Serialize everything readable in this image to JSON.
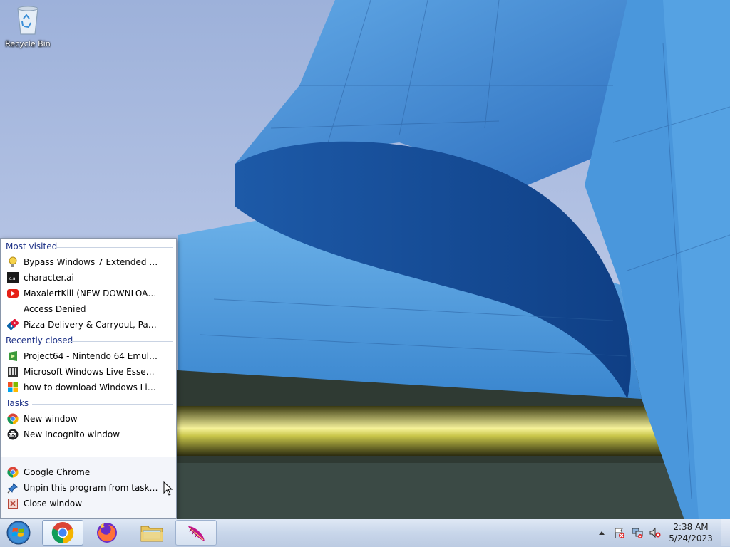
{
  "desktop": {
    "icons": [
      {
        "label": "Recycle Bin",
        "icon": "recycle-bin-icon"
      }
    ]
  },
  "jumplist": {
    "most_visited_header": "Most visited",
    "most_visited": [
      {
        "label": "Bypass Windows 7 Extended Sec...",
        "icon": "lightbulb-icon"
      },
      {
        "label": "character.ai",
        "icon": "character-ai-icon"
      },
      {
        "label": "MaxalertKill (NEW DOWNLOAD L...",
        "icon": "youtube-icon"
      },
      {
        "label": "Access Denied",
        "icon": "blank-page-icon"
      },
      {
        "label": "Pizza Delivery & Carryout, Pasta, ...",
        "icon": "dominos-icon"
      }
    ],
    "recently_closed_header": "Recently closed",
    "recently_closed": [
      {
        "label": "Project64 - Nintendo 64 Emulator",
        "icon": "project64-icon"
      },
      {
        "label": "Microsoft Windows Live Essential...",
        "icon": "archive-icon"
      },
      {
        "label": "how to download Windows Live ...",
        "icon": "microsoft-icon"
      }
    ],
    "tasks_header": "Tasks",
    "tasks": [
      {
        "label": "New window",
        "icon": "chrome-icon"
      },
      {
        "label": "New Incognito window",
        "icon": "incognito-icon"
      }
    ],
    "bottom": [
      {
        "label": "Google Chrome",
        "icon": "chrome-icon"
      },
      {
        "label": "Unpin this program from taskbar",
        "icon": "unpin-icon"
      },
      {
        "label": "Close window",
        "icon": "close-window-icon"
      }
    ]
  },
  "taskbar": {
    "apps": [
      {
        "name": "Google Chrome",
        "icon": "chrome-icon",
        "state": "active"
      },
      {
        "name": "Firefox",
        "icon": "firefox-icon",
        "state": "pinned"
      },
      {
        "name": "Windows Explorer",
        "icon": "folder-icon",
        "state": "pinned"
      },
      {
        "name": "Feather app",
        "icon": "feather-icon",
        "state": "running"
      }
    ],
    "clock": {
      "time": "2:38 AM",
      "date": "5/24/2023"
    }
  },
  "colors": {
    "header_text": "#1e3287",
    "sky": "#b9c7e6",
    "building_blue": "#2f78c8"
  }
}
